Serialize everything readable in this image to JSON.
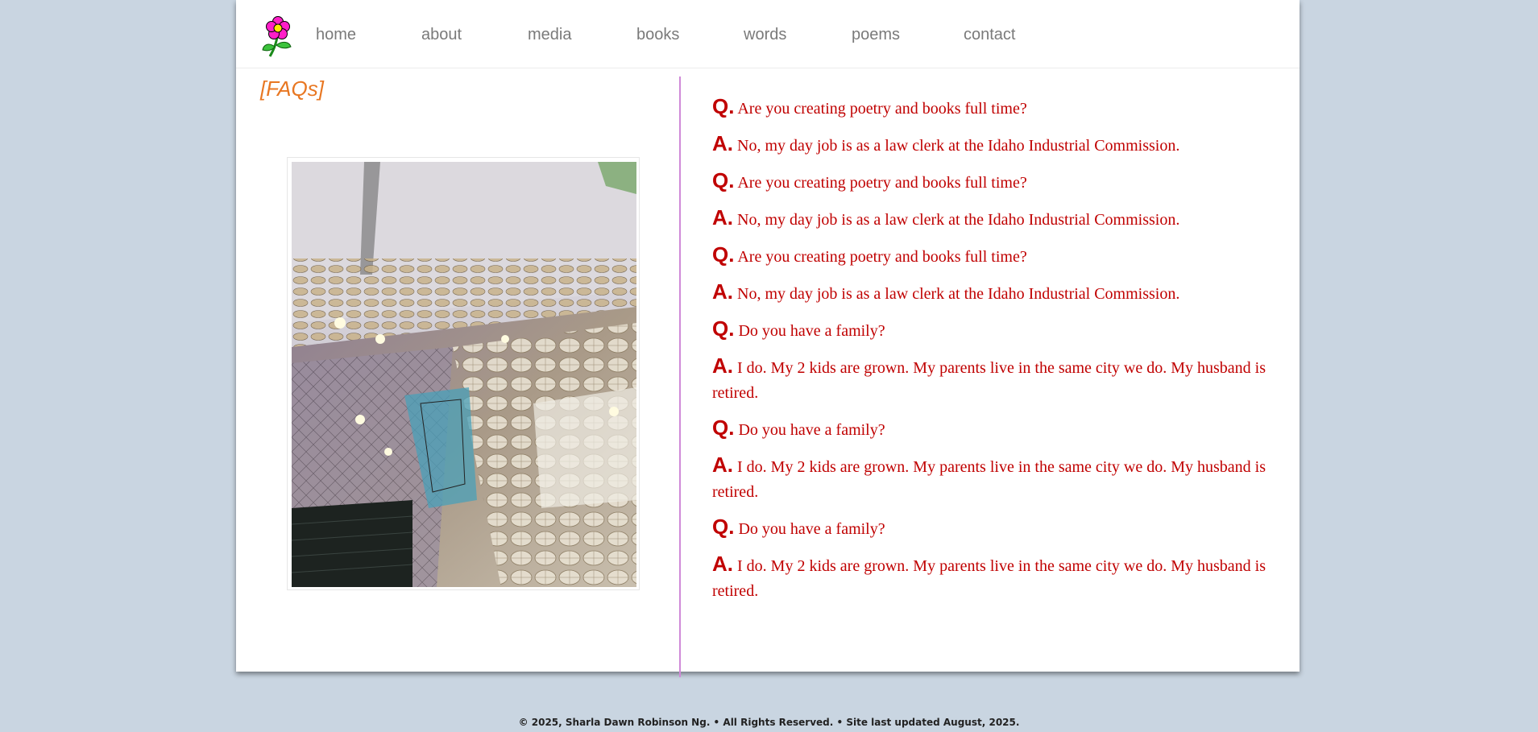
{
  "nav": {
    "logo_icon": "flower-icon",
    "links": [
      {
        "label": "home"
      },
      {
        "label": "about"
      },
      {
        "label": "media"
      },
      {
        "label": "books"
      },
      {
        "label": "words"
      },
      {
        "label": "poems"
      },
      {
        "label": "contact"
      }
    ]
  },
  "heading": "[FAQs]",
  "faqs": [
    {
      "q_mark": "Q.",
      "question": "Are you creating poetry and books full time?",
      "a_mark": "A.",
      "answer": "No, my day job is as a law clerk at the Idaho Industrial Commission."
    },
    {
      "q_mark": "Q.",
      "question": "Are you creating poetry and books full time?",
      "a_mark": "A.",
      "answer": "No, my day job is as a law clerk at the Idaho Industrial Commission."
    },
    {
      "q_mark": "Q.",
      "question": "Are you creating poetry and books full time?",
      "a_mark": "A.",
      "answer": "No, my day job is as a law clerk at the Idaho Industrial Commission."
    },
    {
      "q_mark": "Q.",
      "question": "Do you have a family?",
      "a_mark": "A.",
      "answer": "I do. My 2 kids are grown. My parents live in the same city we do. My husband is retired."
    },
    {
      "q_mark": "Q.",
      "question": "Do you have a family?",
      "a_mark": "A.",
      "answer": "I do. My 2 kids are grown. My parents live in the same city we do. My husband is retired."
    },
    {
      "q_mark": "Q.",
      "question": "Do you have a family?",
      "a_mark": "A.",
      "answer": "I do. My 2 kids are grown. My parents live in the same city we do. My husband is retired."
    }
  ],
  "footer": "© 2025, Sharla Dawn Robinson Ng. • All Rights Reserved. • Site last updated August, 2025.",
  "colors": {
    "background": "#c9d5e1",
    "heading": "#e87722",
    "faq_text": "#c00000",
    "divider": "#d08ad8",
    "nav_text": "#7a7a7a"
  }
}
